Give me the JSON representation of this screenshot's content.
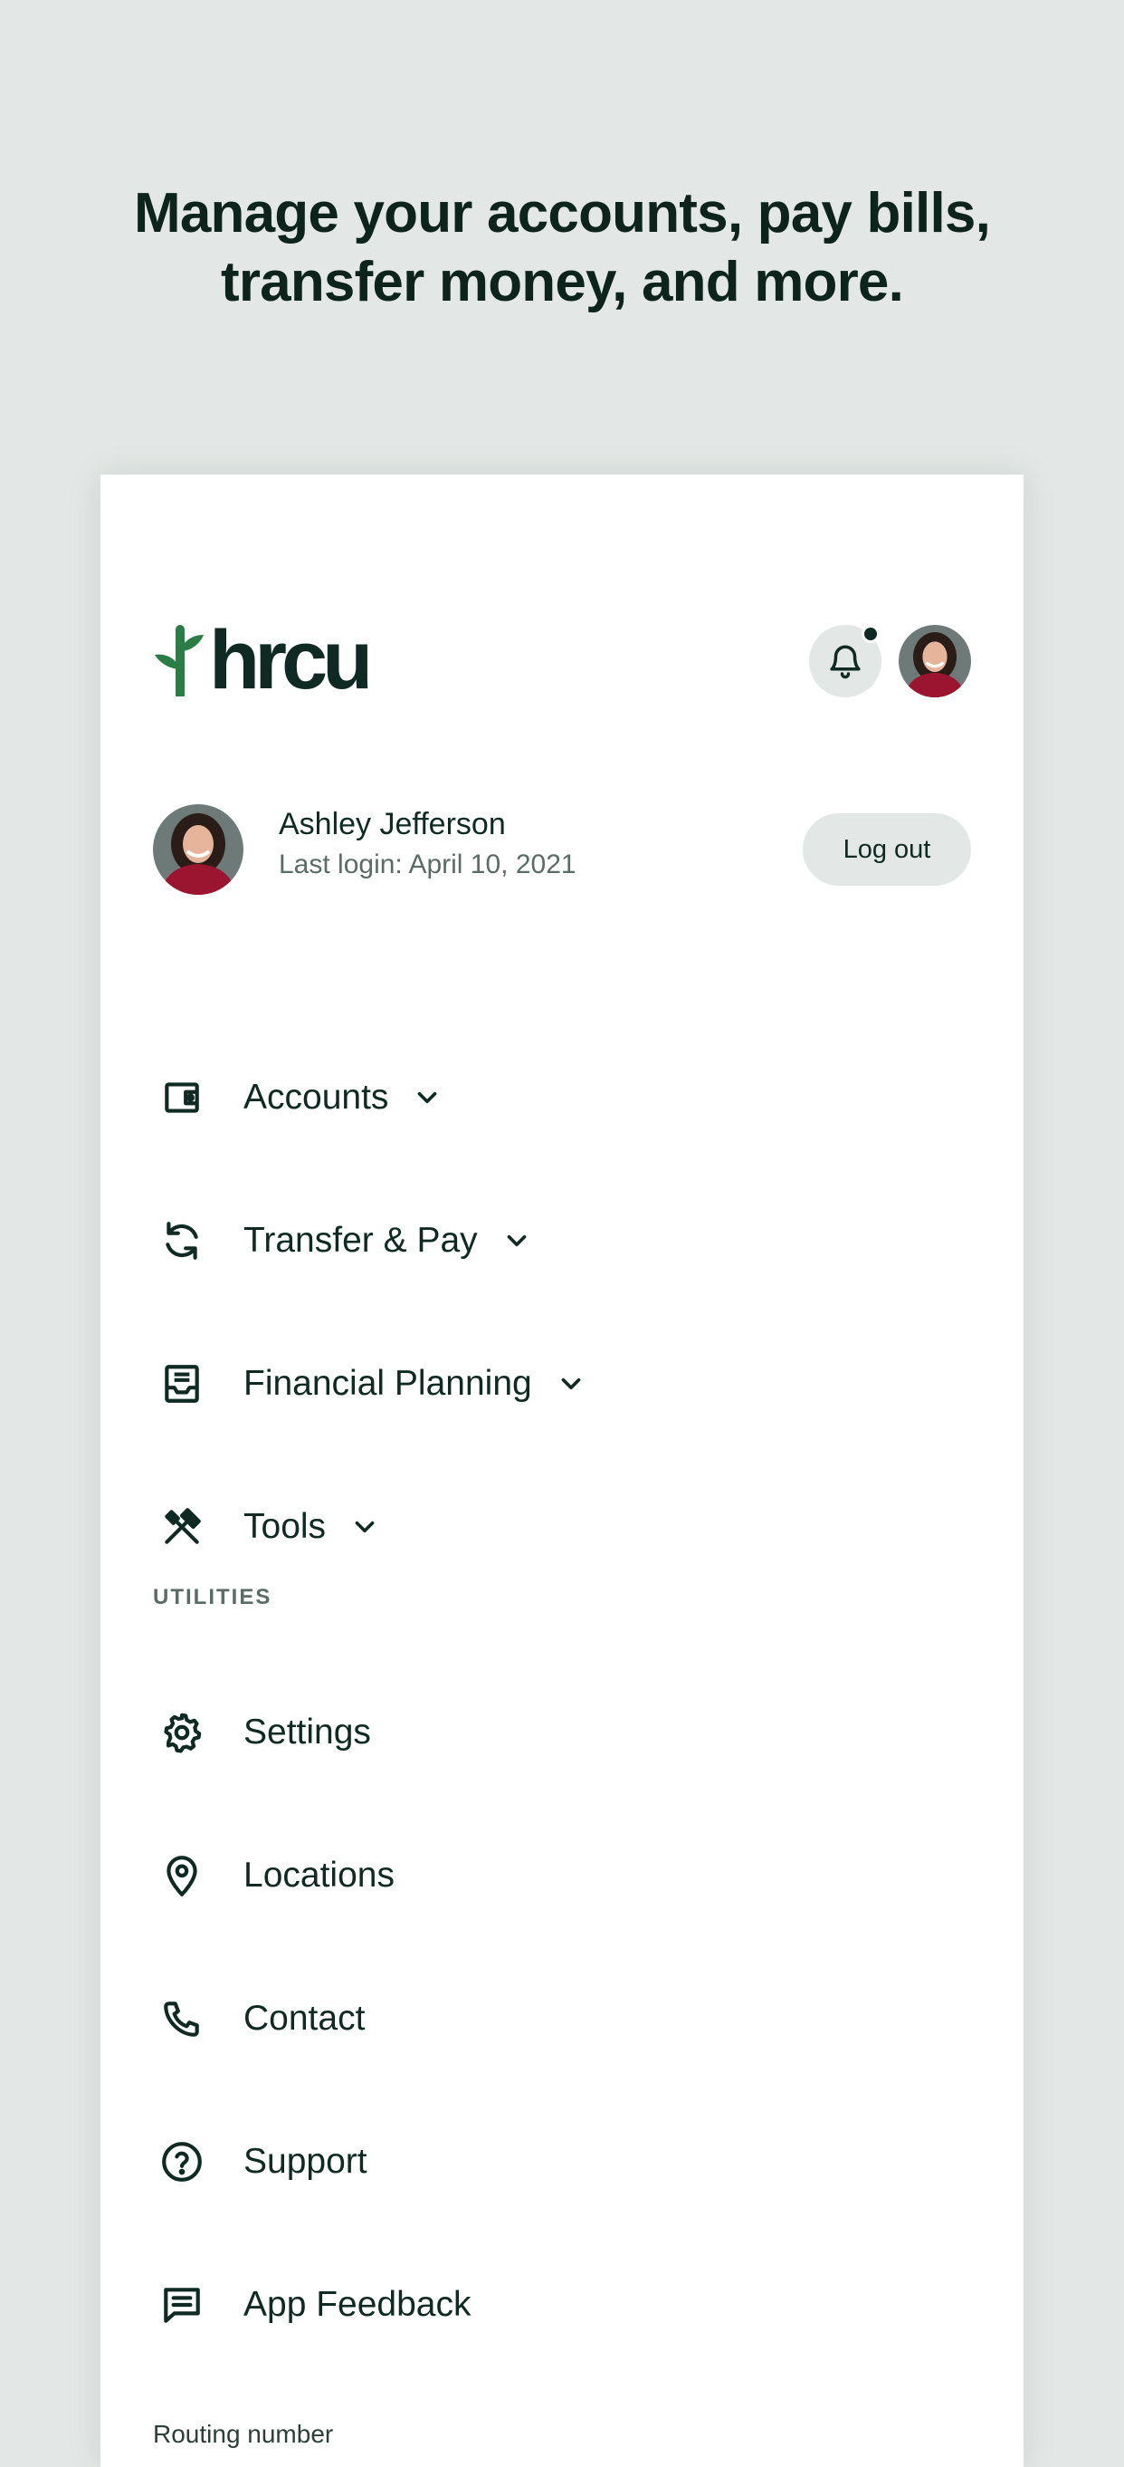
{
  "hero": {
    "line1": "Manage your accounts, pay bills,",
    "line2": "transfer money, and more."
  },
  "header": {
    "logo_text": "hrcu",
    "notification_icon": "bell-icon",
    "has_unread_notifications": true
  },
  "user": {
    "name": "Ashley Jefferson",
    "last_login": "Last login: April 10, 2021",
    "logout_label": "Log out"
  },
  "nav": {
    "main": [
      {
        "label": "Accounts",
        "icon": "wallet-icon"
      },
      {
        "label": "Transfer & Pay",
        "icon": "sync-icon"
      },
      {
        "label": "Financial Planning",
        "icon": "inbox-icon"
      },
      {
        "label": "Tools",
        "icon": "tools-icon"
      }
    ],
    "section_label": "UTILITIES",
    "utilities": [
      {
        "label": "Settings",
        "icon": "gear-icon"
      },
      {
        "label": "Locations",
        "icon": "location-pin-icon"
      },
      {
        "label": "Contact",
        "icon": "phone-icon"
      },
      {
        "label": "Support",
        "icon": "help-circle-icon"
      },
      {
        "label": "App Feedback",
        "icon": "feedback-icon"
      }
    ]
  },
  "footer": {
    "routing_label": "Routing number"
  },
  "colors": {
    "background": "#e3e7e5",
    "card": "#ffffff",
    "text_primary": "#0f2a22",
    "text_secondary": "#5b6b66",
    "brand_green": "#2a7d45"
  }
}
